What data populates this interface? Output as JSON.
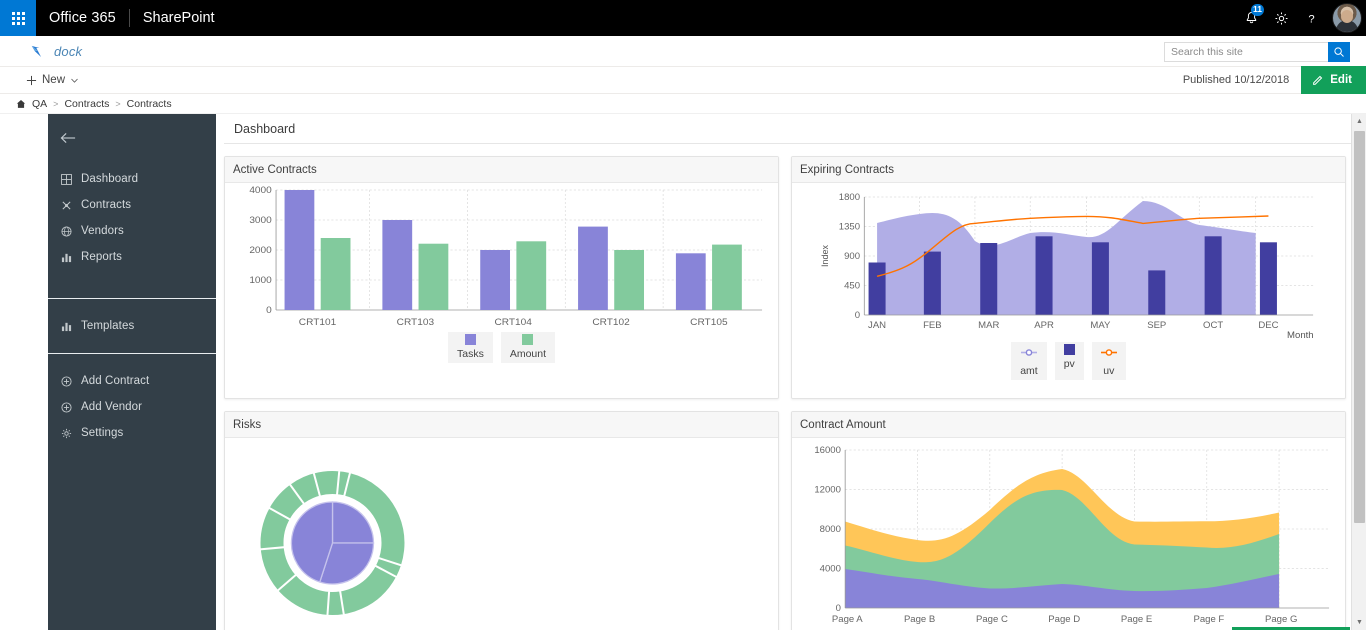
{
  "suite": {
    "waffle": "app-launcher",
    "brand": "Office 365",
    "app": "SharePoint",
    "notifications_count": "11",
    "icons": {
      "bell": "notifications-icon",
      "gear": "settings-icon",
      "help": "help-icon",
      "avatar": "user-avatar"
    }
  },
  "site": {
    "logo_alt": "dock-logo",
    "title": "dock"
  },
  "search": {
    "placeholder": "Search this site",
    "value": "",
    "button": "search-button"
  },
  "command": {
    "new_label": "New",
    "published_label": "Published 10/12/2018",
    "edit_label": "Edit"
  },
  "breadcrumb": {
    "home": "home-icon",
    "items": [
      "QA",
      "Contracts",
      "Contracts"
    ],
    "separator": ">"
  },
  "sidenav": {
    "back": "back-arrow",
    "primary": [
      {
        "label": "Dashboard",
        "icon": "grid-icon"
      },
      {
        "label": "Contracts",
        "icon": "contract-icon"
      },
      {
        "label": "Vendors",
        "icon": "globe-icon"
      },
      {
        "label": "Reports",
        "icon": "chart-icon"
      }
    ],
    "secondary": [
      {
        "label": "Templates",
        "icon": "chart-icon"
      }
    ],
    "tertiary": [
      {
        "label": "Add Contract",
        "icon": "plus-circle-icon"
      },
      {
        "label": "Add Vendor",
        "icon": "plus-circle-icon"
      },
      {
        "label": "Settings",
        "icon": "gear-icon"
      }
    ]
  },
  "page": {
    "title": "Dashboard"
  },
  "cards": {
    "active_contracts": "Active Contracts",
    "expiring_contracts": "Expiring Contracts",
    "risks": "Risks",
    "contract_amount": "Contract Amount"
  },
  "colors": {
    "purple": "#8884d8",
    "green": "#82ca9d",
    "orange": "#ffc658",
    "dark_purple": "#413ea0",
    "area_purple": "#b1aee6",
    "line_orange": "#ff7300",
    "accent_blue": "#0078d4",
    "edit_green": "#12a05a",
    "sidenav_bg": "#333f48"
  },
  "chart_data": [
    {
      "type": "bar",
      "title": "Active Contracts",
      "categories": [
        "CRT101",
        "CRT103",
        "CRT104",
        "CRT102",
        "CRT105"
      ],
      "series": [
        {
          "name": "Tasks",
          "values": [
            4000,
            3000,
            2000,
            2780,
            1890
          ],
          "color": "#8884d8"
        },
        {
          "name": "Amount",
          "values": [
            2400,
            2210,
            2290,
            2000,
            2181
          ],
          "color": "#82ca9d"
        }
      ],
      "ylim": [
        0,
        4000
      ],
      "yticks": [
        0,
        1000,
        2000,
        3000,
        4000
      ],
      "xlabel": "",
      "ylabel": "",
      "grid": true,
      "legend": "bottom"
    },
    {
      "type": "area",
      "title": "Expiring Contracts",
      "categories": [
        "JAN",
        "FEB",
        "MAR",
        "APR",
        "MAY",
        "SEP",
        "OCT",
        "DEC"
      ],
      "series": [
        {
          "name": "amt",
          "kind": "area",
          "values": [
            1400,
            1506,
            989,
            1228,
            1100,
            1700,
            1208,
            1108
          ],
          "color": "#b1aee6"
        },
        {
          "name": "pv",
          "kind": "bar",
          "values": [
            800,
            967,
            1098,
            1200,
            1108,
            680,
            1200,
            1108
          ],
          "color": "#413ea0"
        },
        {
          "name": "uv",
          "kind": "line",
          "values": [
            590,
            868,
            1397,
            1480,
            1520,
            1400,
            1480,
            1520
          ],
          "color": "#ff7300"
        }
      ],
      "ylim": [
        0,
        1800
      ],
      "yticks": [
        0,
        450,
        900,
        1350,
        1800
      ],
      "xlabel": "Month",
      "ylabel": "Index",
      "grid": true,
      "legend": "bottom"
    },
    {
      "type": "pie",
      "title": "Risks",
      "inner": {
        "name": "inner-pie",
        "values": [
          400,
          300,
          300
        ],
        "color": "#8884d8"
      },
      "outer": {
        "name": "outer-ring",
        "values": [
          2400,
          4567,
          1398,
          9800,
          3908,
          4800,
          3800,
          4300
        ],
        "color": "#82ca9d"
      },
      "legend": "none"
    },
    {
      "type": "area",
      "stacked": true,
      "title": "Contract Amount",
      "categories": [
        "Page A",
        "Page B",
        "Page C",
        "Page D",
        "Page E",
        "Page F",
        "Page G"
      ],
      "series": [
        {
          "name": "uv",
          "values": [
            4000,
            3000,
            2000,
            2780,
            1890,
            2390,
            3490
          ],
          "color": "#8884d8"
        },
        {
          "name": "pv",
          "values": [
            2400,
            1398,
            9800,
            3908,
            4800,
            3800,
            4300
          ],
          "color": "#82ca9d"
        },
        {
          "name": "amt",
          "values": [
            2400,
            2210,
            2290,
            2000,
            2181,
            2500,
            2100
          ],
          "color": "#ffc658"
        }
      ],
      "ylim": [
        0,
        16000
      ],
      "yticks": [
        0,
        4000,
        8000,
        12000,
        16000
      ],
      "xlabel": "",
      "ylabel": "",
      "grid": true,
      "legend": "none"
    }
  ]
}
